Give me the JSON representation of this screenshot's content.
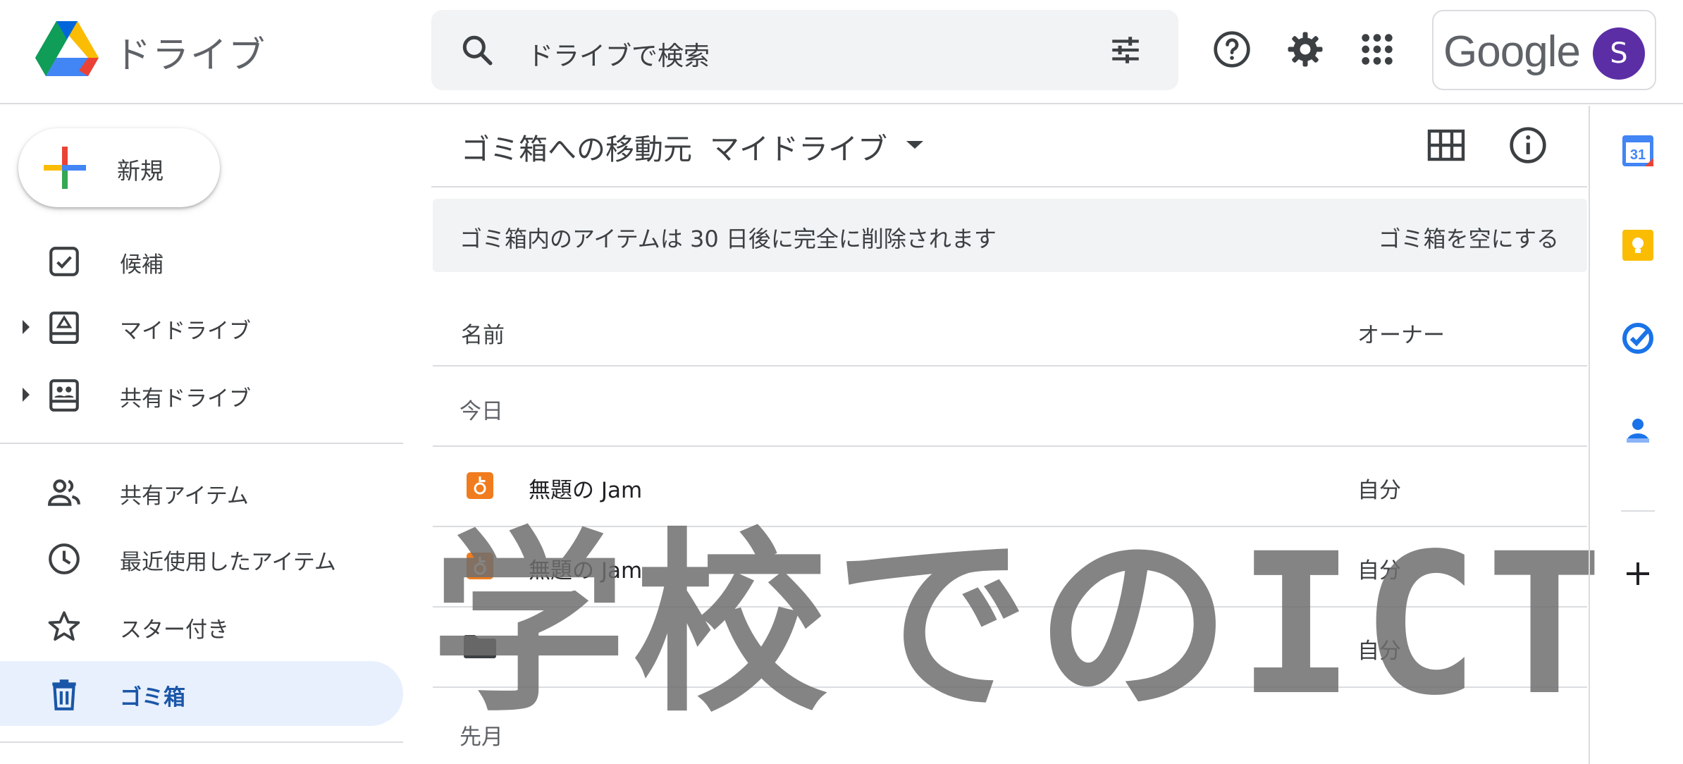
{
  "header": {
    "app_name": "ドライブ",
    "search_placeholder": "ドライブで検索",
    "account_brand": "Google",
    "avatar_letter": "S"
  },
  "sidebar": {
    "new_label": "新規",
    "items": [
      {
        "label": "候補",
        "icon": "check-box-icon"
      },
      {
        "label": "マイドライブ",
        "icon": "my-drive-icon"
      },
      {
        "label": "共有ドライブ",
        "icon": "shared-drives-icon"
      },
      {
        "label": "共有アイテム",
        "icon": "people-icon"
      },
      {
        "label": "最近使用したアイテム",
        "icon": "clock-icon"
      },
      {
        "label": "スター付き",
        "icon": "star-icon"
      },
      {
        "label": "ゴミ箱",
        "icon": "trash-icon"
      }
    ],
    "active_color": "#1a56a8"
  },
  "main": {
    "title_prefix": "ゴミ箱への移動元",
    "title_dropdown": "マイドライブ",
    "banner_message": "ゴミ箱内のアイテムは 30 日後に完全に削除されます",
    "banner_action": "ゴミ箱を空にする",
    "columns": {
      "name": "名前",
      "owner": "オーナー"
    },
    "sections": [
      {
        "label": "今日",
        "files": [
          {
            "name": "無題の Jam",
            "owner": "自分",
            "icon": "jamboard-icon"
          },
          {
            "name": "無題の Jam",
            "owner": "自分",
            "icon": "jamboard-icon"
          },
          {
            "name": "",
            "owner": "自分",
            "icon": "folder-icon"
          }
        ]
      },
      {
        "label": "先月",
        "files": []
      }
    ]
  },
  "watermark": {
    "text": "学校でのICT"
  },
  "colors": {
    "jam_orange": "#f07c1f",
    "avatar": "#5b2ea6",
    "active_bg": "#e8f0fe"
  }
}
